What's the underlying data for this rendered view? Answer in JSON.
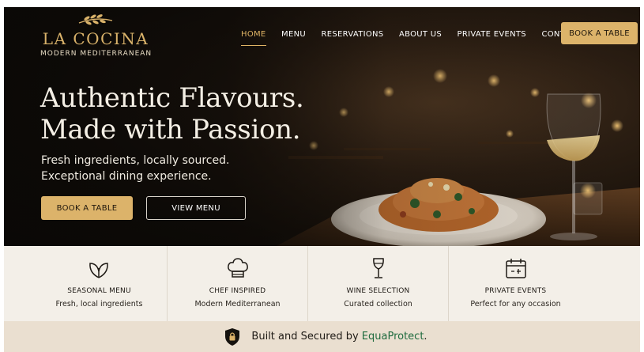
{
  "brand": {
    "name": "LA COCINA",
    "tagline": "MODERN MEDITERRANEAN",
    "gold": "#dcb36a",
    "icon": "olive-branch-icon"
  },
  "nav": {
    "items": [
      {
        "label": "HOME",
        "active": true
      },
      {
        "label": "MENU",
        "active": false
      },
      {
        "label": "RESERVATIONS",
        "active": false
      },
      {
        "label": "ABOUT US",
        "active": false
      },
      {
        "label": "PRIVATE EVENTS",
        "active": false
      },
      {
        "label": "CONTACT",
        "active": false
      }
    ],
    "cta": "BOOK A TABLE"
  },
  "hero": {
    "headline_1": "Authentic Flavours.",
    "headline_2": "Made with Passion.",
    "sub_1": "Fresh ingredients, locally sourced.",
    "sub_2": "Exceptional dining experience.",
    "primary_button": "BOOK A TABLE",
    "secondary_button": "VIEW MENU"
  },
  "features": [
    {
      "icon": "leaf-icon",
      "title": "SEASONAL MENU",
      "subtitle": "Fresh, local ingredients"
    },
    {
      "icon": "chef-hat-icon",
      "title": "CHEF INSPIRED",
      "subtitle": "Modern Mediterranean"
    },
    {
      "icon": "wine-glass-icon",
      "title": "WINE SELECTION",
      "subtitle": "Curated collection"
    },
    {
      "icon": "calendar-icon",
      "title": "PRIVATE EVENTS",
      "subtitle": "Perfect for any occasion"
    }
  ],
  "security": {
    "icon": "shield-lock-icon",
    "text": "Built and Secured by ",
    "brand": "EquaProtect",
    "suffix": ".",
    "brand_color": "#1f6b3e"
  }
}
